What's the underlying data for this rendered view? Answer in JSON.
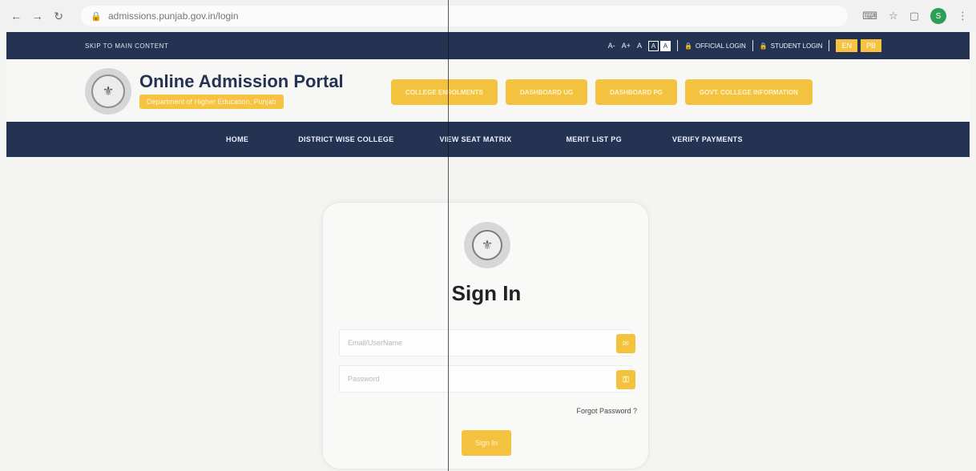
{
  "browser": {
    "address": "admissions.punjab.gov.in/login",
    "profile_initial": "S"
  },
  "topbar": {
    "skip_link": "SKIP TO MAIN CONTENT",
    "font_small": "A-",
    "font_increase": "A+",
    "font_normal": "A",
    "contrast_light": "A",
    "contrast_dark": "A",
    "official_login": "OFFICIAL LOGIN",
    "student_login": "STUDENT LOGIN",
    "lang_en": "EN",
    "lang_pb": "PB"
  },
  "header": {
    "title": "Online Admission Portal",
    "subtitle": "Department of Higher Education, Punjab",
    "buttons": [
      "COLLEGE ENROLMENTS",
      "DASHBOARD UG",
      "DASHBOARD PG",
      "GOVT. COLLEGE INFORMATION"
    ]
  },
  "menu": {
    "home": "HOME",
    "district": "DISTRICT WISE COLLEGE",
    "seat": "VIEW SEAT MATRIX",
    "merit": "MERIT LIST PG",
    "verify": "VERIFY PAYMENTS"
  },
  "login": {
    "title": "Sign In",
    "email_placeholder": "Email/UserName",
    "password_placeholder": "Password",
    "forgot": "Forgot Password ?",
    "submit": "Sign In"
  },
  "colors": {
    "navy": "#253352",
    "accent": "#f3c23f",
    "page_bg": "#f4f4f2"
  }
}
